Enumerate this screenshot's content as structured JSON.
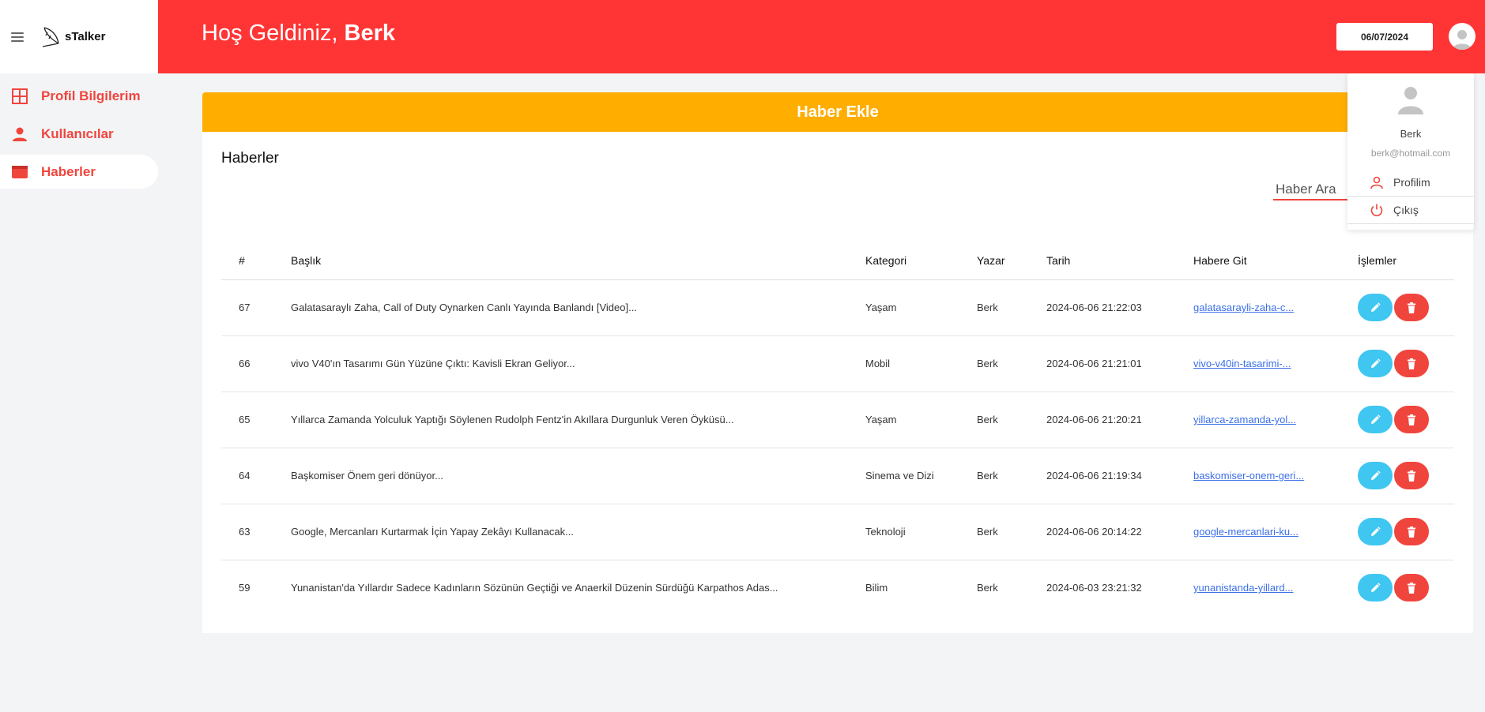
{
  "sidebar": {
    "logo_text": "sTalker",
    "items": [
      {
        "label": "Profil Bilgilerim",
        "icon": "grid-icon"
      },
      {
        "label": "Kullanıcılar",
        "icon": "person-icon"
      },
      {
        "label": "Haberler",
        "icon": "newspaper-icon"
      }
    ]
  },
  "header": {
    "welcome": "Hoş Geldiniz,",
    "user": "Berk",
    "date": "06/07/2024"
  },
  "main": {
    "add_button": "Haber Ekle",
    "title": "Haberler",
    "search_placeholder": "Haber Ara",
    "columns": [
      "#",
      "Başlık",
      "Kategori",
      "Yazar",
      "Tarih",
      "Habere Git",
      "İşlemler"
    ],
    "rows": [
      {
        "id": "67",
        "title": "Galatasaraylı Zaha, Call of Duty Oynarken Canlı Yayında Banlandı [Video]...",
        "category": "Yaşam",
        "author": "Berk",
        "date": "2024-06-06 21:22:03",
        "link": "galatasarayli-zaha-c..."
      },
      {
        "id": "66",
        "title": "vivo V40'ın Tasarımı Gün Yüzüne Çıktı: Kavisli Ekran Geliyor...",
        "category": "Mobil",
        "author": "Berk",
        "date": "2024-06-06 21:21:01",
        "link": "vivo-v40in-tasarimi-..."
      },
      {
        "id": "65",
        "title": "Yıllarca Zamanda Yolculuk Yaptığı Söylenen Rudolph Fentz'in Akıllara Durgunluk Veren Öyküsü...",
        "category": "Yaşam",
        "author": "Berk",
        "date": "2024-06-06 21:20:21",
        "link": "yillarca-zamanda-yol..."
      },
      {
        "id": "64",
        "title": "Başkomiser Önem geri dönüyor...",
        "category": "Sinema ve Dizi",
        "author": "Berk",
        "date": "2024-06-06 21:19:34",
        "link": "baskomiser-onem-geri..."
      },
      {
        "id": "63",
        "title": "Google, Mercanları Kurtarmak İçin Yapay Zekâyı Kullanacak...",
        "category": "Teknoloji",
        "author": "Berk",
        "date": "2024-06-06 20:14:22",
        "link": "google-mercanlari-ku..."
      },
      {
        "id": "59",
        "title": "Yunanistan'da Yıllardır Sadece Kadınların Sözünün Geçtiği ve Anaerkil Düzenin Sürdüğü Karpathos Adas...",
        "category": "Bilim",
        "author": "Berk",
        "date": "2024-06-03 23:21:32",
        "link": "yunanistanda-yillard..."
      }
    ]
  },
  "dropdown": {
    "name": "Berk",
    "email": "berk@hotmail.com",
    "profile_label": "Profilim",
    "logout_label": "Çıkış"
  },
  "colors": {
    "header": "#ff3535",
    "accent": "#f0453d",
    "add_button": "#ffae00",
    "edit_button": "#3fc6f1",
    "delete_button": "#f0453d"
  }
}
